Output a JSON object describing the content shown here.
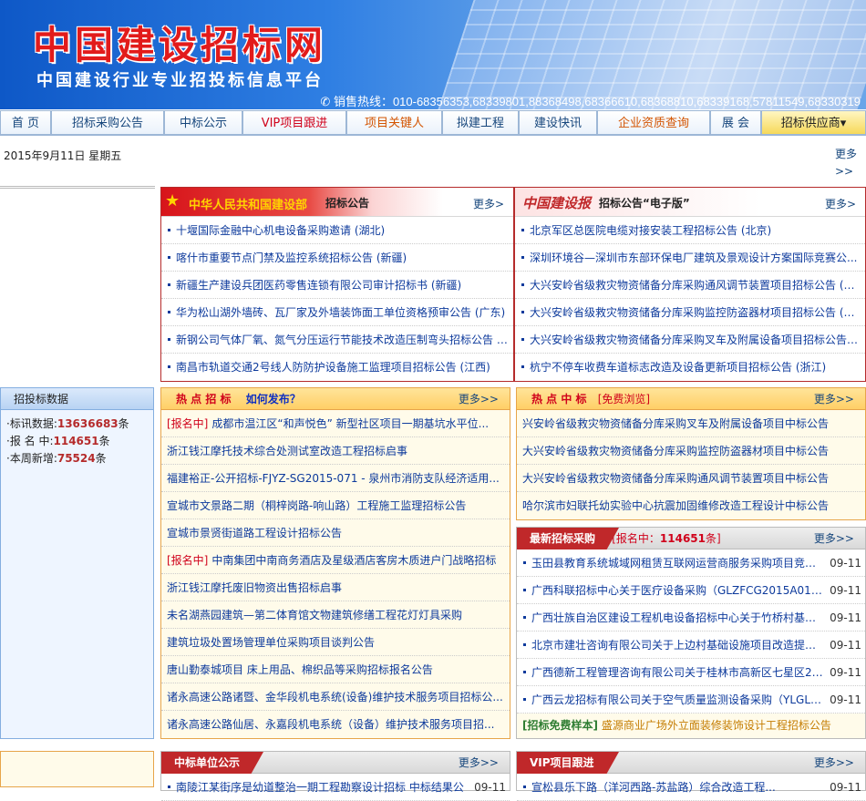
{
  "header": {
    "title": "中国建设招标网",
    "subtitle": "中国建设行业专业招投标信息平台",
    "hotline": "销售热线：010-68356353,68339801,88368498,68366610,68368810,68339168,57811549,68330319"
  },
  "nav": [
    {
      "label": "首 页"
    },
    {
      "label": "招标采购公告"
    },
    {
      "label": "中标公示"
    },
    {
      "label": "VIP项目跟进"
    },
    {
      "label": "项目关键人"
    },
    {
      "label": "拟建工程"
    },
    {
      "label": "建设快讯"
    },
    {
      "label": "企业资质查询"
    },
    {
      "label": "展 会"
    },
    {
      "label": "招标供应商▾"
    }
  ],
  "date": "2015年9月11日  星期五",
  "more_top": "更多>>",
  "ministry": {
    "title": "中华人民共和国建设部",
    "sub": "招标公告",
    "more": "更多>",
    "items": [
      "十堰国际金融中心机电设备采购邀请 (湖北)",
      "喀什市重要节点门禁及监控系统招标公告 (新疆)",
      "新疆生产建设兵团医药零售连锁有限公司审计招标书 (新疆)",
      "华为松山湖外墙砖、瓦厂家及外墙装饰面工单位资格预审公告 (广东)",
      "新钢公司气体厂氧、氮气分压运行节能技术改造压制弯头招标公告 (...",
      "南昌市轨道交通2号线人防防护设备施工监理项目招标公告 (江西)"
    ]
  },
  "electronic": {
    "logo": "中国建设报",
    "title": "招标公告“电子版”",
    "more": "更多>",
    "items": [
      "北京军区总医院电缆对接安装工程招标公告 (北京)",
      "深圳环境谷—深圳市东部环保电厂建筑及景观设计方案国际竞赛公...",
      "大兴安岭省级救灾物资储备分库采购通风调节装置项目招标公告 (黑...",
      "大兴安岭省级救灾物资储备分库采购监控防盗器材项目招标公告 (黑...",
      "大兴安岭省级救灾物资储备分库采购叉车及附属设备项目招标公告 (...",
      "杭宁不停车收费车道标志改造及设备更新项目招标公告 (浙江)"
    ]
  },
  "stats": {
    "title": "招投标数据",
    "l1": "·标讯数据:",
    "v1": "13636683",
    "u1": "条",
    "l2": "·报 名 中:",
    "v2": "114651",
    "u2": "条",
    "l3": "·本周新增:",
    "v3": "75524",
    "u3": "条"
  },
  "hot_bid": {
    "title": "热 点 招 标",
    "howto": "如何发布？",
    "more": "更多>>",
    "items": [
      {
        "tag": "[报名中]",
        "text": "成都市温江区“和声悦色” 新型社区项目一期基坑水平位..."
      },
      {
        "tag": "",
        "text": "浙江钱江摩托技术综合处测试室改造工程招标启事"
      },
      {
        "tag": "",
        "text": "福建裕正-公开招标-FJYZ-SG2015-071 - 泉州市消防支队经济适用..."
      },
      {
        "tag": "",
        "text": "宣城市文景路二期（桐梓岗路-响山路）工程施工监理招标公告"
      },
      {
        "tag": "",
        "text": "宣城市景贤街道路工程设计招标公告"
      },
      {
        "tag": "[报名中]",
        "text": "中南集团中南商务酒店及星级酒店客房木质进户门战略招标"
      },
      {
        "tag": "",
        "text": "浙江钱江摩托废旧物资出售招标启事"
      },
      {
        "tag": "",
        "text": "未名湖燕园建筑—第二体育馆文物建筑修缮工程花灯灯具采购"
      },
      {
        "tag": "",
        "text": "建筑垃圾处置场管理单位采购项目谈判公告"
      },
      {
        "tag": "",
        "text": "唐山勤泰城项目 床上用品、棉织品等采购招标报名公告"
      },
      {
        "tag": "",
        "text": "诸永高速公路诸暨、金华段机电系统(设备)维护技术服务项目招标公..."
      },
      {
        "tag": "",
        "text": "诸永高速公路仙居、永嘉段机电系统（设备）维护技术服务项目招..."
      }
    ]
  },
  "hot_win": {
    "title": "热 点 中 标",
    "free": "[免费浏览]",
    "more": "更多>>",
    "items": [
      "兴安岭省级救灾物资储备分库采购叉车及附属设备项目中标公告",
      "大兴安岭省级救灾物资储备分库采购监控防盗器材项目中标公告",
      "大兴安岭省级救灾物资储备分库采购通风调节装置项目中标公告",
      "哈尔滨市妇联托幼实验中心抗震加固维修改造工程设计中标公告"
    ]
  },
  "latest": {
    "title": "最新招标采购",
    "sub_pre": "[报名中：",
    "sub_val": "114651",
    "sub_post": "条]",
    "more": "更多>>",
    "items": [
      {
        "t": "玉田县教育系统城域网租赁互联网运营商服务采购项目竞争...",
        "d": "09-11"
      },
      {
        "t": "广西科联招标中心关于医疗设备采购（GLZFCG2015A0182...",
        "d": "09-11"
      },
      {
        "t": "广西壮族自治区建设工程机电设备招标中心关于竹桥村基础...",
        "d": "09-11"
      },
      {
        "t": "北京市建壮咨询有限公司关于上边村基础设施项目改造提升...",
        "d": "09-11"
      },
      {
        "t": "广西德新工程管理咨询有限公司关于桂林市高新区七星区20...",
        "d": "09-11"
      },
      {
        "t": "广西云龙招标有限公司关于空气质量监测设备采购（YLGLG...",
        "d": "09-11"
      }
    ],
    "sample_tag": "[招标免费样本]",
    "sample": "盛源商业广场外立面装修装饰设计工程招标公告"
  },
  "winners": {
    "title": "中标单位公示",
    "more": "更多>>",
    "row": "南陵江某街序是幼道整治一期工程勘察设计招标 中标结果公",
    "date": "09-11"
  },
  "vip": {
    "title": "VIP项目跟进",
    "more": "更多>>",
    "row": "宣松县乐下路（洋河西路-苏盐路）综合改造工程...",
    "date": "09-11"
  }
}
